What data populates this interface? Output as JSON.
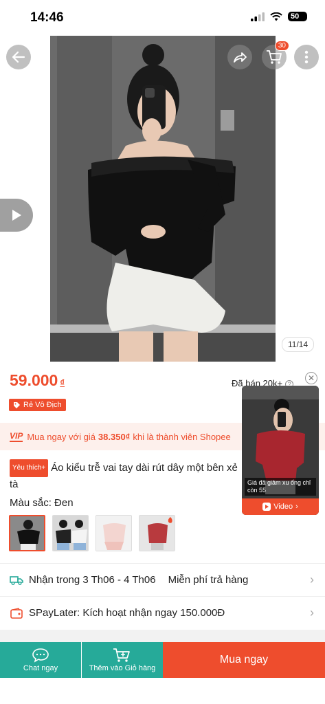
{
  "status": {
    "time": "14:46",
    "battery": "50"
  },
  "header": {
    "cart_count": "30"
  },
  "gallery": {
    "counter": "11/14"
  },
  "product": {
    "price": "59.000",
    "currency": "₫",
    "sold": "Đã bán 20k+",
    "badge": "Rẻ Vô Địch",
    "favorite_badge": "Yêu thích+",
    "title": "Áo kiểu trễ vai tay dài rút dây một bên xẻ tà"
  },
  "vip": {
    "tag": "VIP",
    "text_before": "Mua ngay với giá",
    "vip_price": "38.350₫",
    "text_after": "khi là thành viên Shopee"
  },
  "variation": {
    "label": "Màu sắc: Đen"
  },
  "float_video": {
    "caption": "Giá đã giảm xu ống chỉ còn 55",
    "button": "Video"
  },
  "shipping": {
    "delivery": "Nhận trong 3 Th06 - 4 Th06",
    "returns": "Miễn phí trả hàng"
  },
  "payment": {
    "text": "SPayLater: Kích hoạt nhận ngay 150.000Đ"
  },
  "bottom_bar": {
    "chat": "Chat ngay",
    "add_to_cart": "Thêm vào Giỏ hàng",
    "buy_now": "Mua ngay"
  },
  "colors": {
    "accent": "#ee4d2d",
    "teal": "#26aa99"
  }
}
